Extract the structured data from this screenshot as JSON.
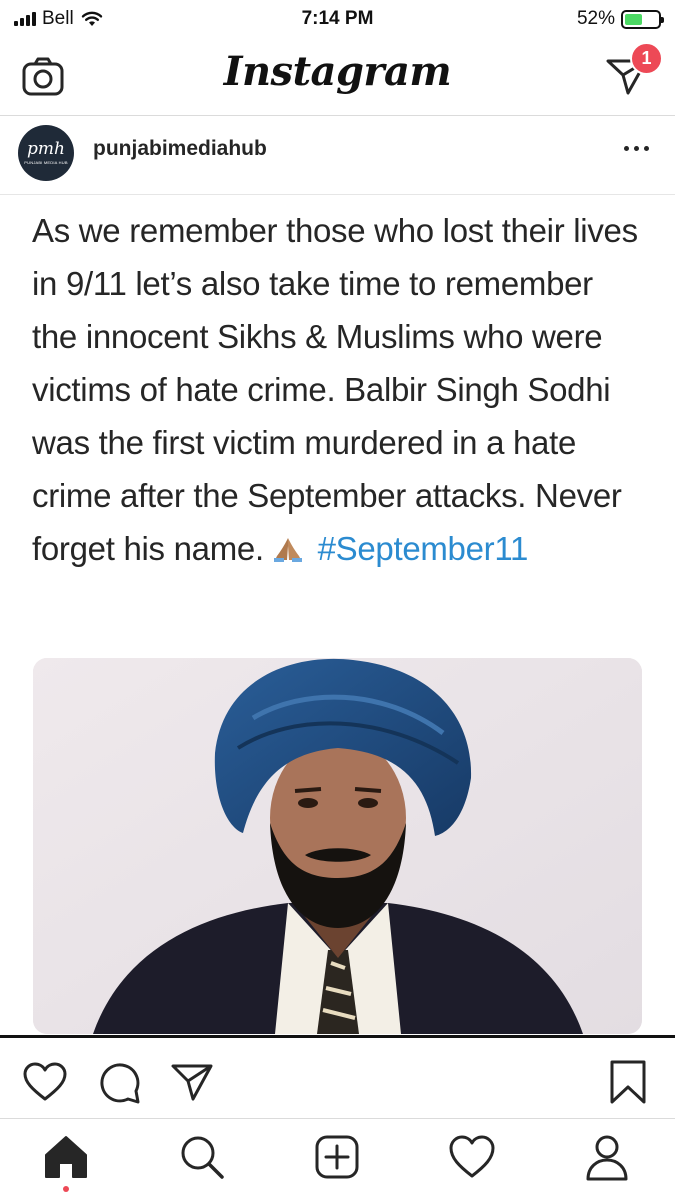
{
  "status_bar": {
    "carrier": "Bell",
    "time": "7:14 PM",
    "battery_percent": "52%",
    "battery_level": 0.52,
    "battery_color": "#4cd964",
    "icons": [
      "signal-bars-icon",
      "wifi-icon",
      "battery-charging-icon"
    ]
  },
  "header": {
    "brand": "Instagram",
    "left_icon": "camera-icon",
    "right_icon": "direct-message-icon",
    "direct_badge_count": "1",
    "badge_color": "#ed4956"
  },
  "post": {
    "username": "punjabimediahub",
    "avatar": {
      "logo_text": "pmh",
      "sub_text": "PUNJABI MEDIA HUB"
    },
    "more_icon": "more-horizontal-icon",
    "caption": {
      "text": "As we remember those who lost their lives in 9/11 let’s also take time to remember the innocent Sikhs & Muslims who were victims of hate crime. Balbir Singh Sodhi was the first victim murdered in a hate crime after the September attacks. Never forget his name.",
      "emoji": "🙏🏽",
      "hashtag": "#September11"
    },
    "image": {
      "description_icon": "portrait-photo",
      "accent_turban": "#1f4f8a",
      "background": "#ece6e9"
    },
    "hashtag_color": "#2b8bd0"
  },
  "actions": {
    "icons": [
      "heart-icon",
      "comment-icon",
      "share-icon",
      "bookmark-icon"
    ]
  },
  "tabbar": {
    "tabs": [
      "home-icon",
      "search-icon",
      "add-post-icon",
      "activity-heart-icon",
      "profile-icon"
    ],
    "active": "home-icon",
    "active_dot_color": "#ed4956"
  }
}
